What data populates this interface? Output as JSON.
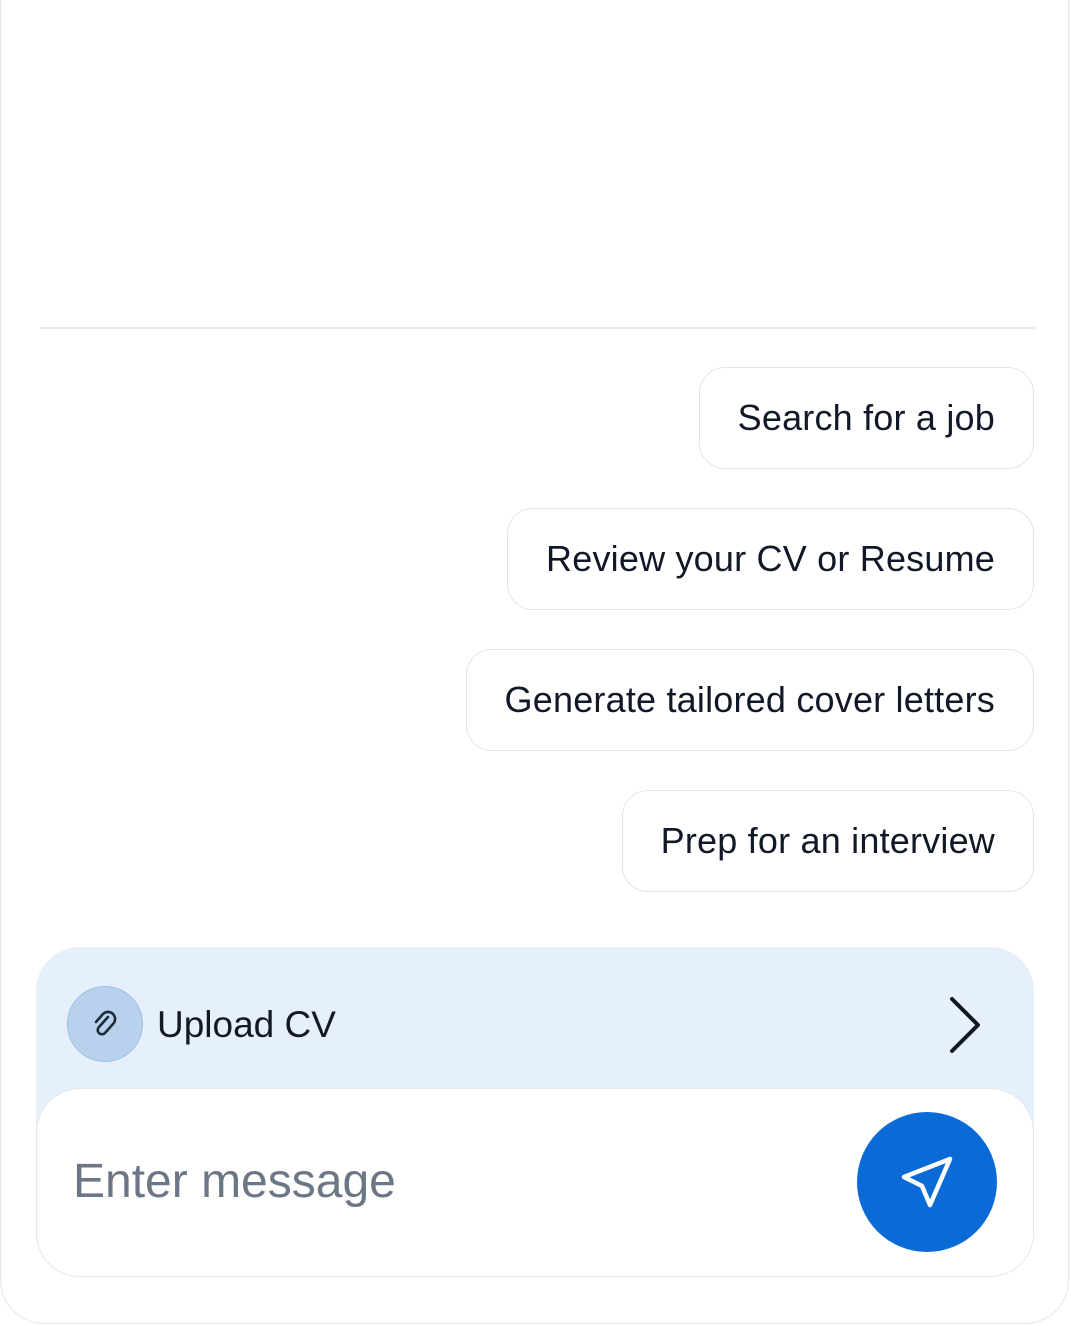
{
  "suggestions": [
    {
      "label": "Search for a job"
    },
    {
      "label": "Review your CV or Resume"
    },
    {
      "label": "Generate tailored cover letters"
    },
    {
      "label": "Prep for an interview"
    }
  ],
  "upload": {
    "label": "Upload CV",
    "icon": "paperclip-icon",
    "chevron_icon": "chevron-right-icon"
  },
  "composer": {
    "placeholder": "Enter message",
    "value": "",
    "send_icon": "send-icon"
  },
  "colors": {
    "accent": "#0a6ad6",
    "composer_bg": "#e6f0fb",
    "clip_circle": "#b8d2ee",
    "text": "#111827",
    "placeholder": "#6b7785"
  }
}
